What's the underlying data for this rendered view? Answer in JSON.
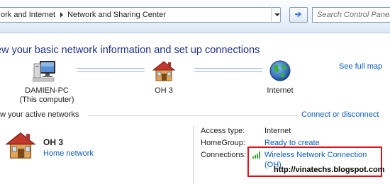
{
  "address_bar": {
    "crumbs": [
      "ork and Internet",
      "Network and Sharing Center"
    ]
  },
  "search": {
    "placeholder": "Search Control Panel"
  },
  "page": {
    "title": "ew your basic network information and set up connections",
    "see_full_map": "See full map"
  },
  "network_map": {
    "nodes": [
      {
        "name": "DAMIEN-PC",
        "subtitle": "(This computer)",
        "icon": "computer-icon"
      },
      {
        "name": "OH  3",
        "icon": "house-icon"
      },
      {
        "name": "Internet",
        "icon": "globe-icon"
      }
    ]
  },
  "active_networks": {
    "heading": "ew your active networks",
    "connect_link": "Connect or disconnect",
    "network": {
      "name": "OH  3",
      "type": "Home network",
      "icon": "house-icon"
    },
    "details": {
      "access_type_label": "Access type:",
      "access_type_value": "Internet",
      "homegroup_label": "HomeGroup:",
      "homegroup_value": "Ready to create",
      "connections_label": "Connections:",
      "connections_value": "Wireless Network Connection",
      "connections_value_2": "(OH)"
    }
  },
  "watermark": "http://vinatechs.blogspot.com",
  "colors": {
    "title": "#1e3287",
    "link": "#0a5cbd",
    "highlight_box": "#e0101a",
    "map_line": "#95b2d6"
  }
}
